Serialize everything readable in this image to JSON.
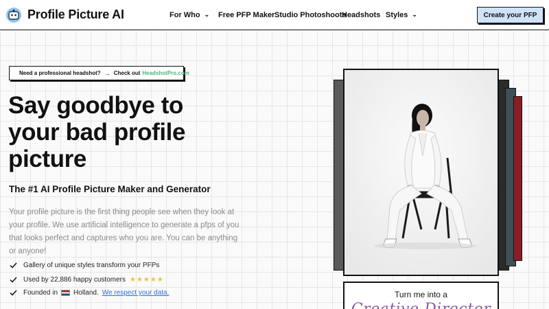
{
  "header": {
    "brand": "Profile Picture AI",
    "nav": [
      {
        "label": "For Who",
        "has_dropdown": true
      },
      {
        "label": "Free PFP Maker",
        "has_dropdown": false
      },
      {
        "label": "Studio Photoshoots",
        "has_dropdown": false
      },
      {
        "label": "Headshots",
        "has_dropdown": false
      },
      {
        "label": "Styles",
        "has_dropdown": true
      }
    ],
    "cta": "Create your PFP",
    "chevron": "⌄"
  },
  "promo": {
    "text": "Need a professional headshot?",
    "arrow": "→",
    "check_out": "Check out",
    "link": "HeadshotPro.com"
  },
  "hero": {
    "title_lines": [
      "Say goodbye to",
      "your bad profile",
      "picture"
    ],
    "subtitle": "The #1 AI Profile Picture Maker and Generator",
    "description": "Your profile picture is the first thing people see when they look at your profile. We use artificial intelligence to generate a pfps of you that looks perfect and captures who you are. You can be anything or anyone!"
  },
  "features": {
    "styles": "Gallery of unique styles transform your PFPs",
    "customers": "Used by 22,886 happy customers",
    "stars": "★★★★★",
    "founded_prefix": "Founded in",
    "founded_place": "Holland.",
    "respect_link": "We respect your data."
  },
  "caption": {
    "line": "Turn me into a",
    "role": "Creative Director"
  },
  "colors": {
    "cta_bg": "#cfe3fb",
    "link_green": "#4ab57a",
    "link_blue": "#2f6fd6",
    "role_purple": "#8a5aa8",
    "star_yellow": "#f2c22a"
  },
  "icons": {
    "logo": "camera-robot-icon",
    "promo": "briefcase-icon",
    "features": "check-icon"
  }
}
